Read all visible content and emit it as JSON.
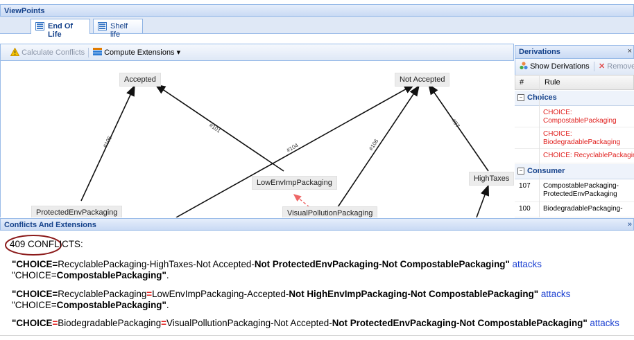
{
  "viewpoints": {
    "title": "ViewPoints",
    "tabs": [
      {
        "label": "End Of Life",
        "active": true
      },
      {
        "label": "Shelf life",
        "active": false
      }
    ]
  },
  "graph_toolbar": {
    "calculate_label": "Calculate Conflicts",
    "compute_label": "Compute Extensions",
    "compute_arrow": "▾"
  },
  "graph": {
    "nodes": {
      "accepted": "Accepted",
      "not_accepted": "Not Accepted",
      "low_env": "LowEnvImpPackaging",
      "high_taxes": "HighTaxes",
      "protected_env": "ProtectedEnvPackaging",
      "visual_pollution": "VisualPollutionPackaging"
    },
    "edge_labels": {
      "e105": "#105",
      "e101": "#101",
      "e104": "#104",
      "e106": "#106",
      "e97": "#97"
    }
  },
  "derivations": {
    "title": "Derivations",
    "close": "×",
    "show_label": "Show Derivations",
    "remove_label": "Remove",
    "col_num": "#",
    "col_rule": "Rule",
    "groups": {
      "choices": {
        "label": "Choices",
        "rows": [
          {
            "num": "",
            "lines": [
              "CHOICE:",
              "CompostablePackaging"
            ]
          },
          {
            "num": "",
            "lines": [
              "CHOICE:",
              "BiodegradablePackaging"
            ]
          },
          {
            "num": "",
            "lines": [
              "CHOICE: RecyclablePackaging"
            ]
          }
        ]
      },
      "consumer": {
        "label": "Consumer",
        "rows": [
          {
            "num": "107",
            "lines": [
              "CompostablePackaging-",
              "ProtectedEnvPackaging"
            ]
          },
          {
            "num": "100",
            "lines": [
              "BiodegradablePackaging-",
              ""
            ]
          }
        ]
      }
    }
  },
  "conflicts": {
    "title": "Conflicts And Extensions",
    "count_text": "409 CONFLICTS:",
    "items": [
      {
        "l1a": "\"CHOICE=",
        "l1b": "RecyclablePackaging-HighTaxes-Not Accepted-",
        "l1c": "Not ProtectedEnvPackaging-Not CompostablePackaging\"",
        "attacks": "attacks",
        "l2a": "\"CHOICE=",
        "l2b": "CompostablePackaging\"",
        "l2c": "."
      },
      {
        "l1a": "\"CHOICE=",
        "l1b": "RecyclablePackaging",
        "l1eq": "=",
        "l1b2": "LowEnvImpPackaging-Accepted-",
        "l1c": "Not HighEnvImpPackaging-Not CompostablePackaging\"",
        "attacks": "attacks",
        "l2a": "\"CHOICE=",
        "l2b": "CompostablePackaging\"",
        "l2c": "."
      },
      {
        "l1a": "\"CHOICE",
        "l1eq0": "=",
        "l1b": "BiodegradablePackaging",
        "l1eq": "=",
        "l1b2": "VisualPollutionPackaging-Not Accepted-",
        "l1c": "Not ProtectedEnvPackaging-Not CompostablePackaging\"",
        "attacks": "attacks"
      }
    ]
  },
  "colors": {
    "header_text": "#15428b",
    "choice_red": "#e0201e",
    "link_blue": "#1a3fd1",
    "circle": "#8b1a1a"
  }
}
